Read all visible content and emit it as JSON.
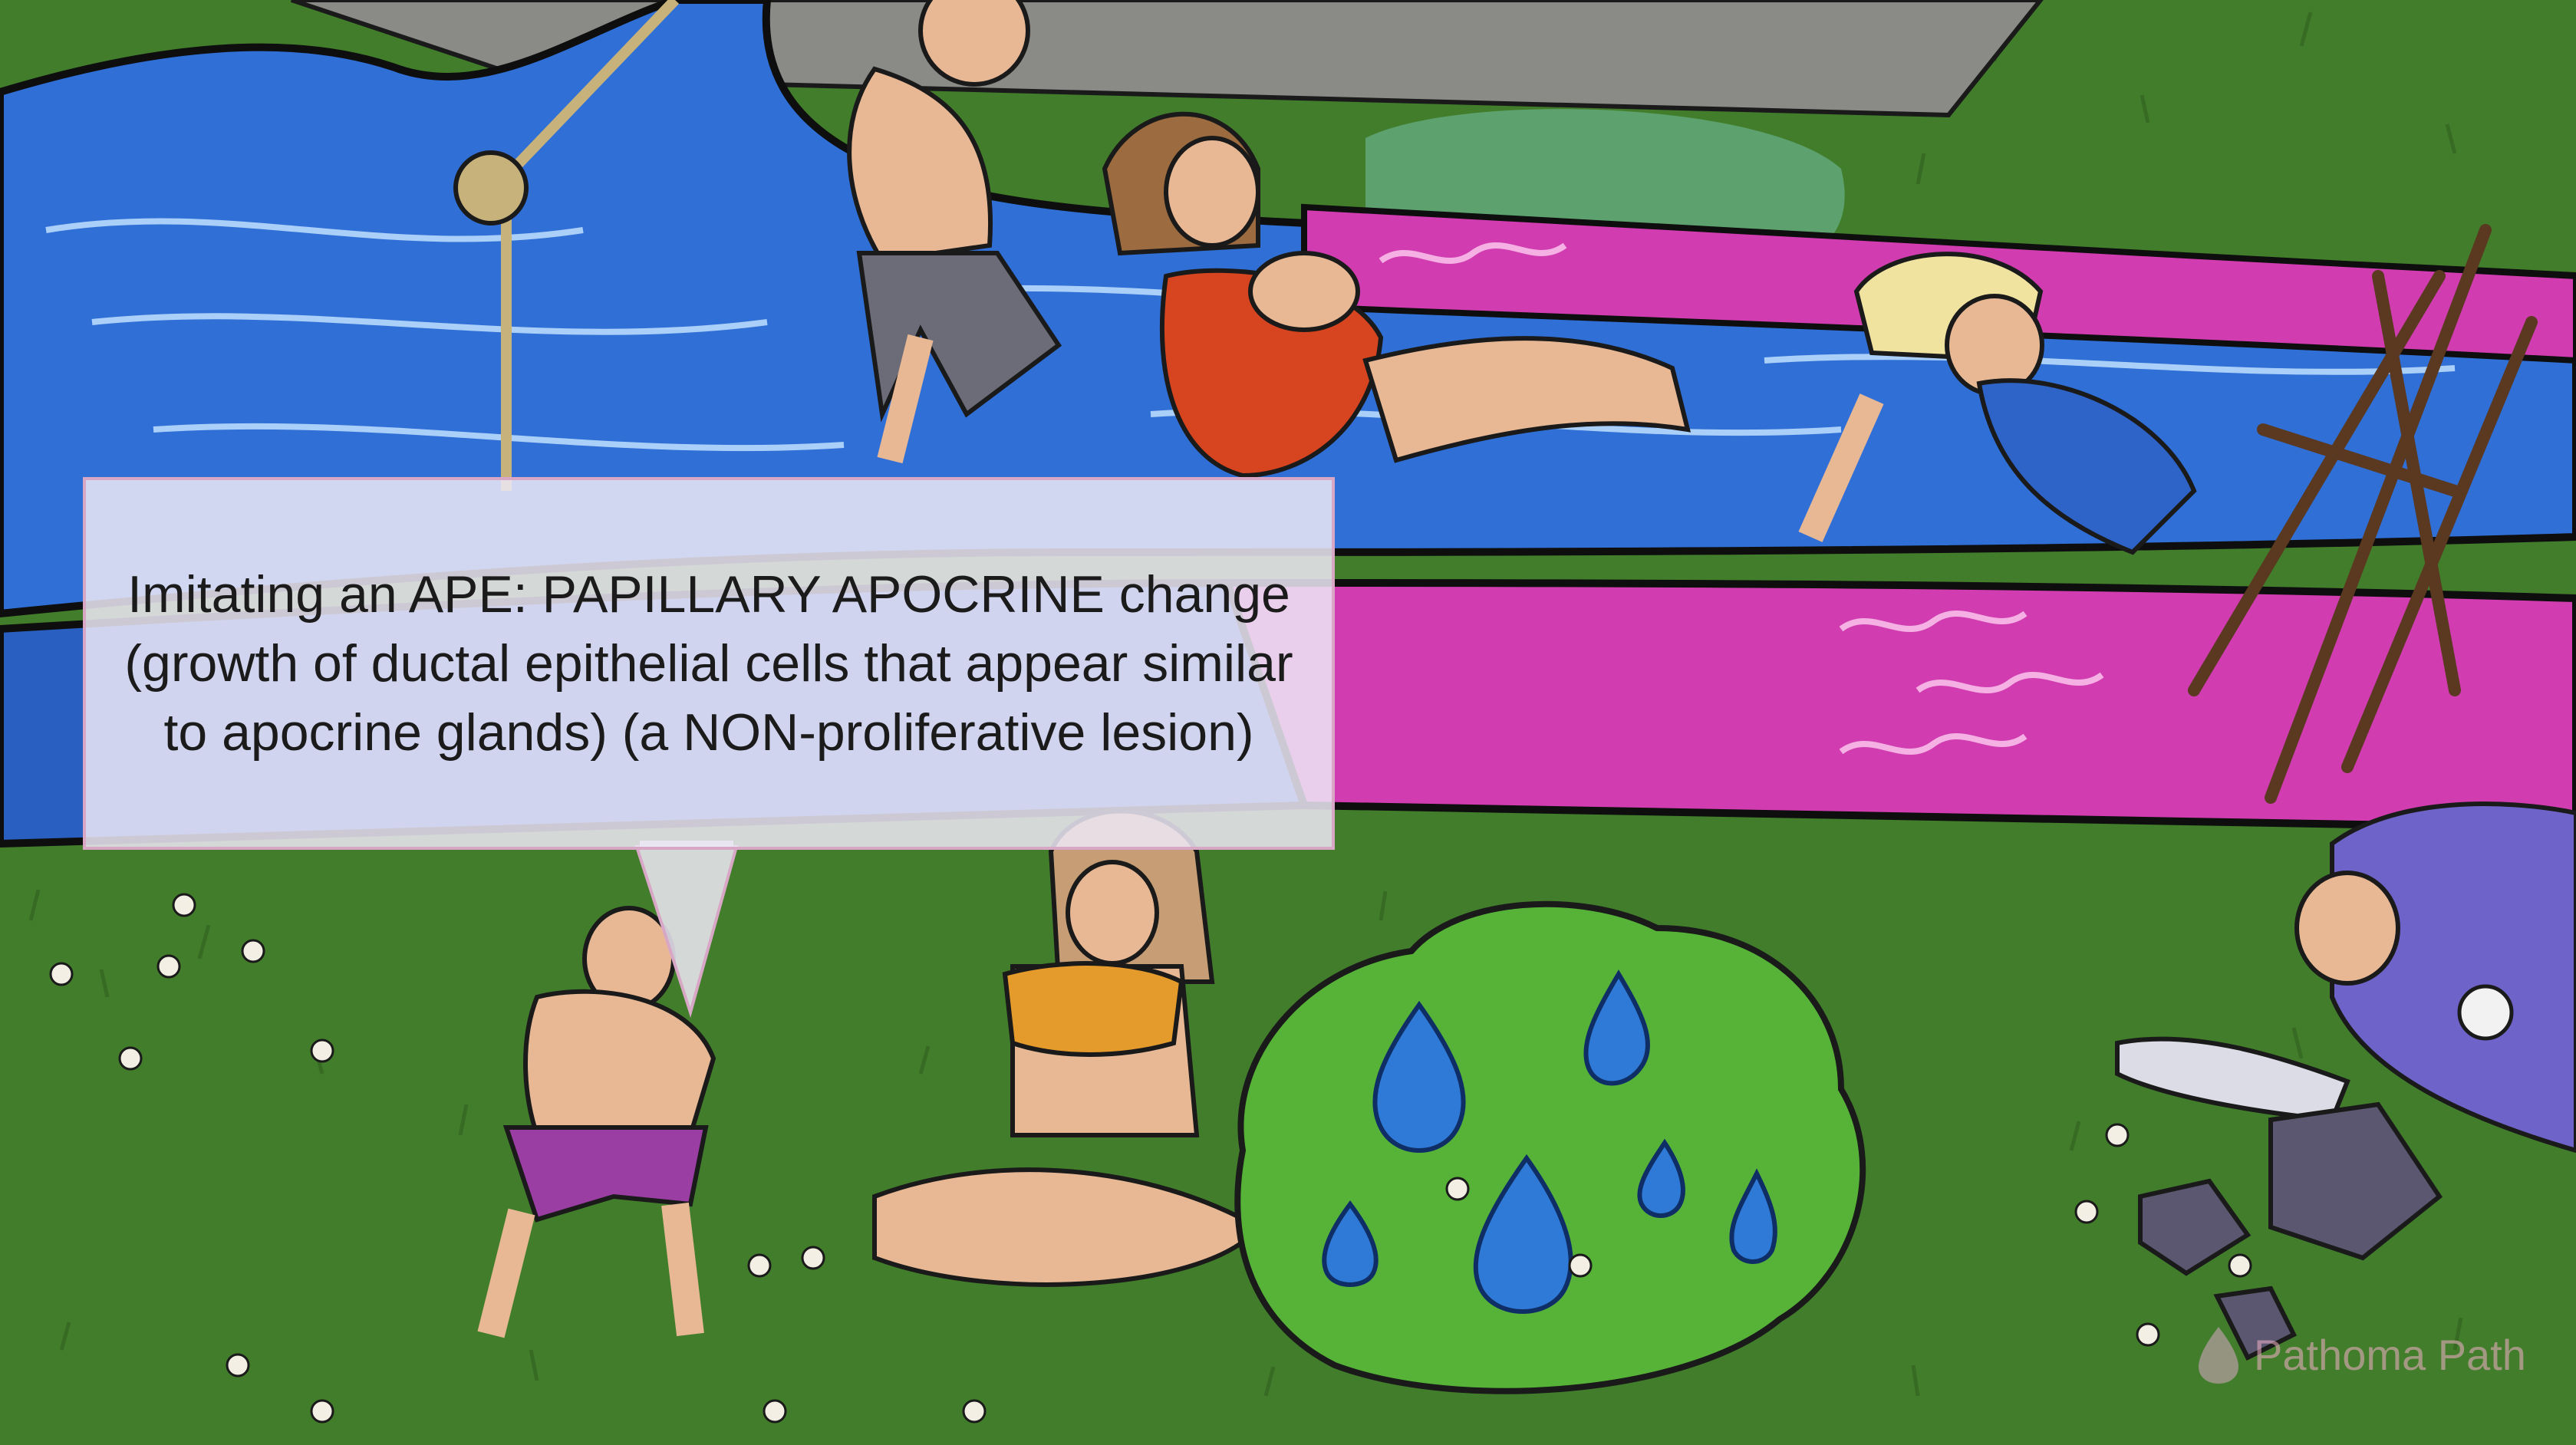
{
  "callout": {
    "text": "Imitating an APE: PAPILLARY APOCRINE change (growth of ductal epithelial cells that appear similar to apocrine glands) (a NON-proliferative lesion)"
  },
  "watermark": {
    "text": "Pathoma Path"
  },
  "colors": {
    "grass": "#3f7a2a",
    "water": "#2f6fd6",
    "slide_pink": "#d13db0",
    "callout_bg": "#ece8f4",
    "callout_border": "#d9a7c6"
  },
  "icons": [
    "water-balloon-icon",
    "watermark-logo-icon"
  ]
}
